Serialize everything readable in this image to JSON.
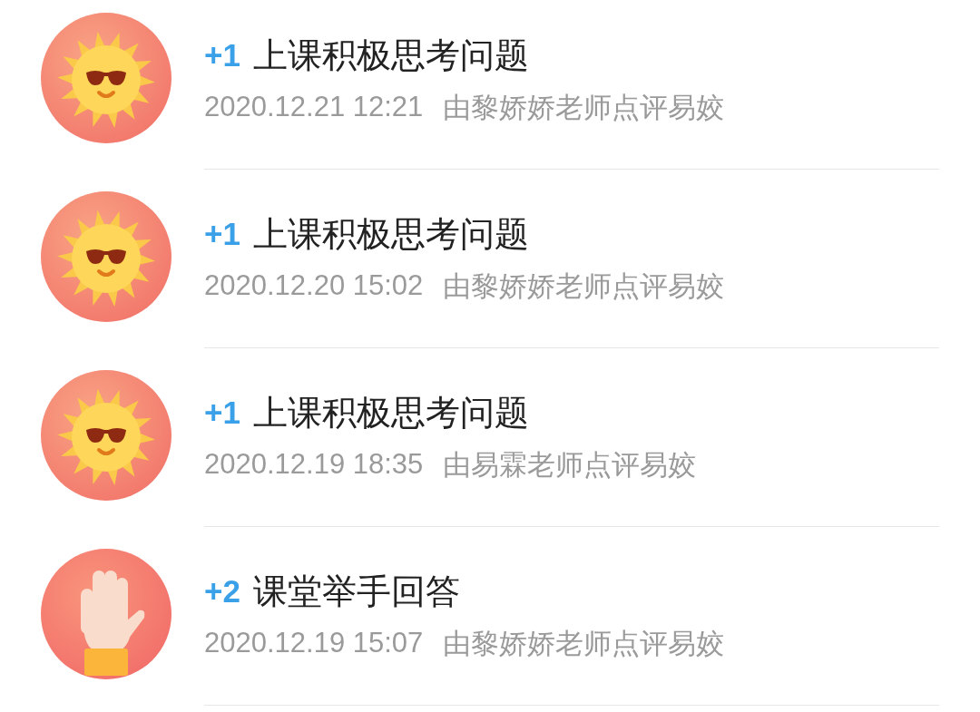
{
  "records": [
    {
      "kind": "sun",
      "points": "+1",
      "title": "上课积极思考问题",
      "time": "2020.12.21 12:21",
      "note": "由黎娇娇老师点评易姣"
    },
    {
      "kind": "sun",
      "points": "+1",
      "title": "上课积极思考问题",
      "time": "2020.12.20 15:02",
      "note": "由黎娇娇老师点评易姣"
    },
    {
      "kind": "sun",
      "points": "+1",
      "title": "上课积极思考问题",
      "time": "2020.12.19 18:35",
      "note": "由易霖老师点评易姣"
    },
    {
      "kind": "hand",
      "points": "+2",
      "title": "课堂举手回答",
      "time": "2020.12.19 15:07",
      "note": "由黎娇娇老师点评易姣"
    }
  ]
}
